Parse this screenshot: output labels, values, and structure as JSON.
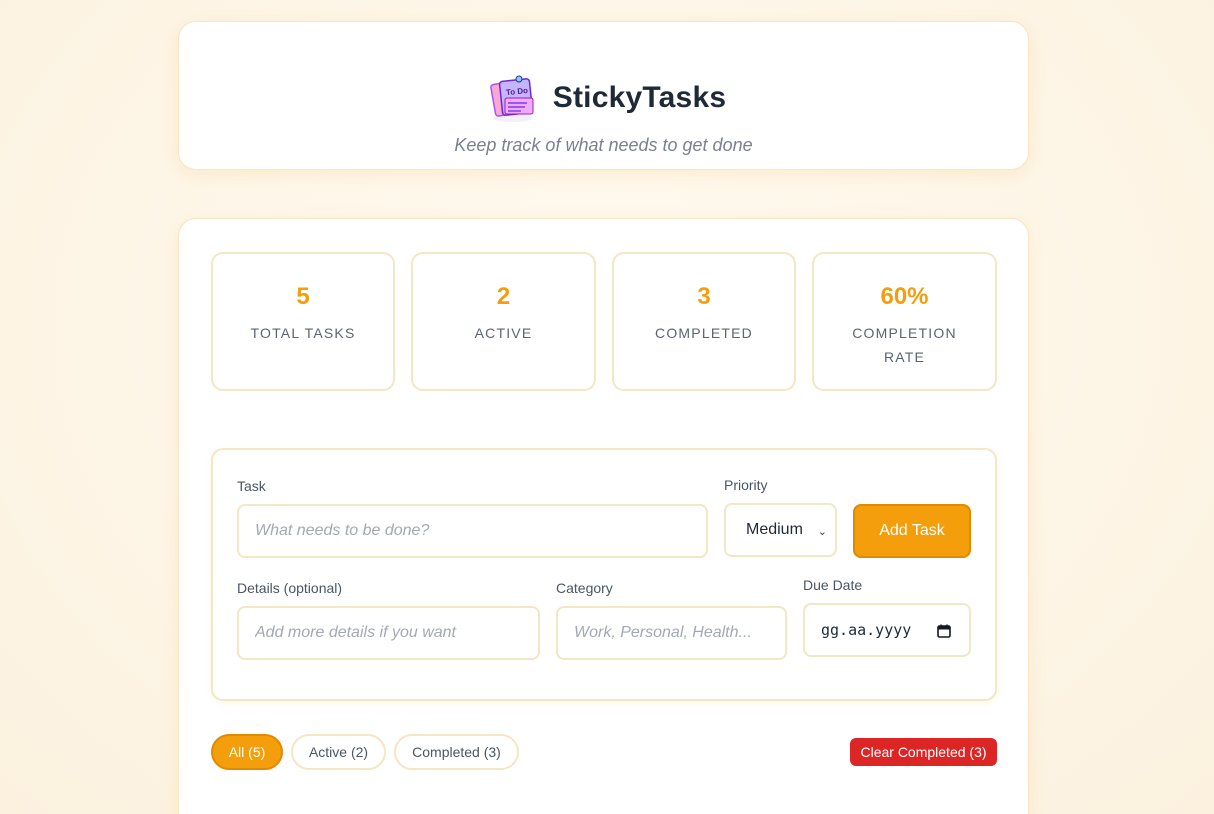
{
  "app": {
    "title": "StickyTasks",
    "tagline": "Keep track of what needs to get done",
    "logo_icon": "sticky-notes-icon",
    "logo_text": "To Do"
  },
  "stats": [
    {
      "value": "5",
      "label": "TOTAL TASKS"
    },
    {
      "value": "2",
      "label": "ACTIVE"
    },
    {
      "value": "3",
      "label": "COMPLETED"
    },
    {
      "value": "60%",
      "label": "COMPLETION RATE"
    }
  ],
  "form": {
    "task_label": "Task",
    "task_placeholder": "What needs to be done?",
    "priority_label": "Priority",
    "priority_value": "Medium",
    "add_button": "Add Task",
    "details_label": "Details (optional)",
    "details_placeholder": "Add more details if you want",
    "category_label": "Category",
    "category_placeholder": "Work, Personal, Health...",
    "due_label": "Due Date",
    "due_placeholder": "gg.aa.yyyy"
  },
  "filters": [
    {
      "label": "All (5)",
      "active": true
    },
    {
      "label": "Active (2)",
      "active": false
    },
    {
      "label": "Completed (3)",
      "active": false
    }
  ],
  "clear_completed": "Clear Completed (3)",
  "colors": {
    "accent": "#f59e0b",
    "danger": "#dc2626",
    "border": "#f5e6c4"
  }
}
